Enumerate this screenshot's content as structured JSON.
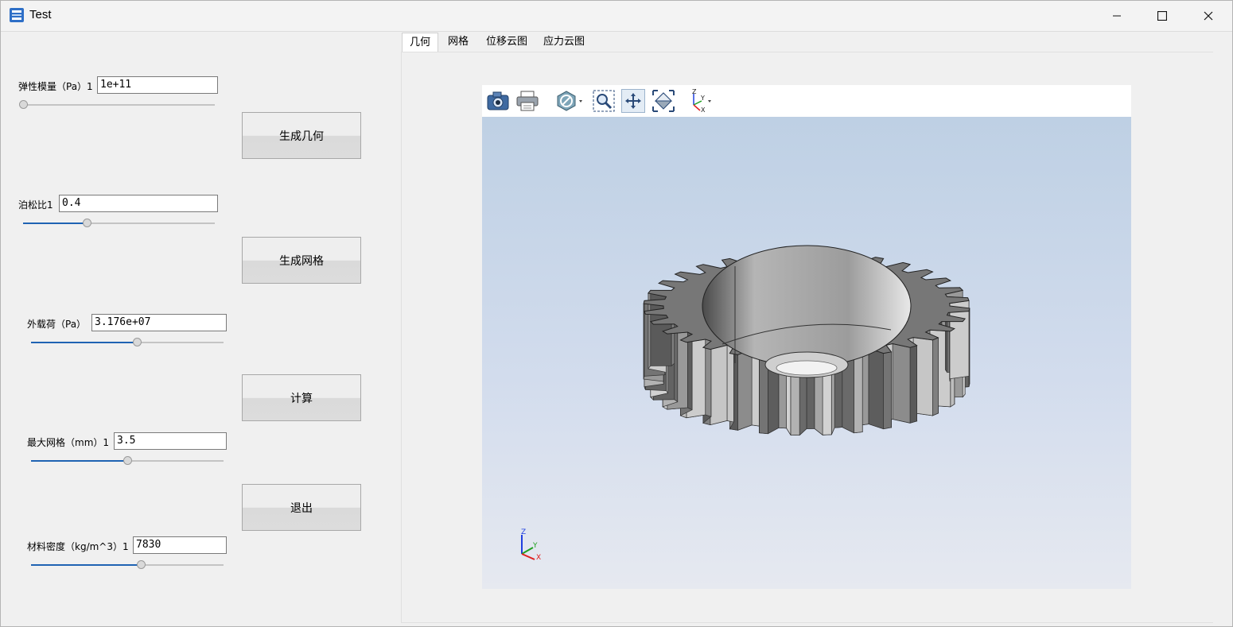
{
  "window": {
    "title": "Test",
    "minimize": "minimize-icon",
    "maximize": "maximize-icon",
    "close": "close-icon",
    "icon": "app-icon"
  },
  "params": [
    {
      "label": "弹性模量（Pa）1",
      "value": "1e+11",
      "slider": 0.0
    },
    {
      "label": "泊松比1",
      "value": "0.4",
      "slider": 0.33
    },
    {
      "label": "外载荷（Pa）",
      "value": "3.176e+07",
      "slider": 0.55
    },
    {
      "label": "最大网格（mm）1",
      "value": "3.5",
      "slider": 0.5
    },
    {
      "label": "材料密度（kg/m^3）1",
      "value": "7830",
      "slider": 0.57
    }
  ],
  "buttons": {
    "geometry": "生成几何",
    "mesh": "生成网格",
    "compute": "计算",
    "exit": "退出"
  },
  "tabs": [
    "几何",
    "网格",
    "位移云图",
    "应力云图"
  ],
  "active_tab": 0,
  "viewer": {
    "toolbar": [
      "camera-icon",
      "print-icon",
      "display-mode-icon",
      "zoom-box-icon",
      "pan-icon",
      "fit-all-icon",
      "axes-view-icon"
    ],
    "axis_labels": {
      "z": "Z",
      "y": "Y",
      "x": "X"
    },
    "colors": {
      "x": "#e02020",
      "y": "#20a020",
      "z": "#2040e0",
      "gear": "#9a9a9a"
    },
    "model": "gear"
  }
}
